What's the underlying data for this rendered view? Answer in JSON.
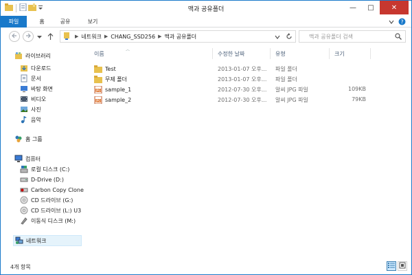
{
  "window": {
    "title": "맥과 공유폴더",
    "controls": {
      "minimize": "—",
      "maximize": "□",
      "close": "✕"
    }
  },
  "ribbon": {
    "tabs": [
      "파일",
      "홈",
      "공유",
      "보기"
    ]
  },
  "address": {
    "crumbs": [
      "네트워크",
      "CHANG_SSD256",
      "맥과 공유폴더"
    ],
    "search_placeholder": "맥과 공유폴더 검색"
  },
  "navpane": {
    "libraries": {
      "label": "라이브러리",
      "items": [
        "다운로드",
        "문서",
        "바탕 화면",
        "비디오",
        "사진",
        "음악"
      ]
    },
    "homegroup": "홈 그룹",
    "computer": {
      "label": "컴퓨터",
      "items": [
        "로컬 디스크 (C:)",
        "D-Drive (D:)",
        "Carbon Copy Clone",
        "CD 드라이브 (G:)",
        "CD 드라이브 (L:) U3",
        "이동식 디스크 (M:)"
      ]
    },
    "network": "네트워크"
  },
  "columns": {
    "name": "이름",
    "date": "수정한 날짜",
    "type": "유형",
    "size": "크기"
  },
  "files": [
    {
      "name": "Test",
      "date": "2013-01-07 오후...",
      "type": "파일 폴더",
      "size": "",
      "icon": "folder-icon"
    },
    {
      "name": "무제 폴더",
      "date": "2013-01-07 오후...",
      "type": "파일 폴더",
      "size": "",
      "icon": "folder-icon"
    },
    {
      "name": "sample_1",
      "date": "2012-07-30 오후...",
      "type": "알씨 JPG 파일",
      "size": "109KB",
      "icon": "jpg-file-icon"
    },
    {
      "name": "sample_2",
      "date": "2012-07-30 오후...",
      "type": "알씨 JPG 파일",
      "size": "79KB",
      "icon": "jpg-file-icon"
    }
  ],
  "status": {
    "item_count": "4개 항목"
  },
  "colors": {
    "accent": "#1979ca",
    "close": "#c7372f",
    "folder": "#e8c14e",
    "selection": "#e5f3fb"
  }
}
